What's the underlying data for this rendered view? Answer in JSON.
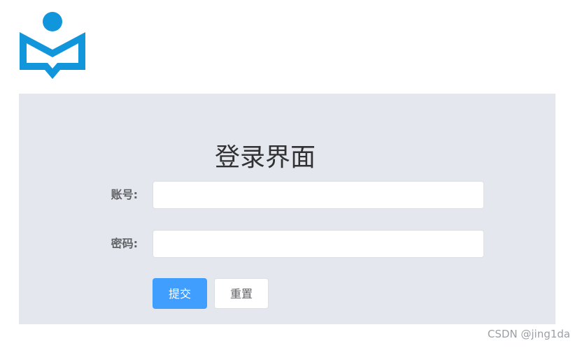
{
  "logo": {
    "icon": "open-book-reader-icon",
    "color": "#1296db"
  },
  "login": {
    "title": "登录界面",
    "account_label": "账号:",
    "account_value": "",
    "password_label": "密码:",
    "password_value": "",
    "submit_label": "提交",
    "reset_label": "重置"
  },
  "colors": {
    "panel_background": "#e4e7ed",
    "primary": "#409eff"
  },
  "watermark": "CSDN @jing1da"
}
